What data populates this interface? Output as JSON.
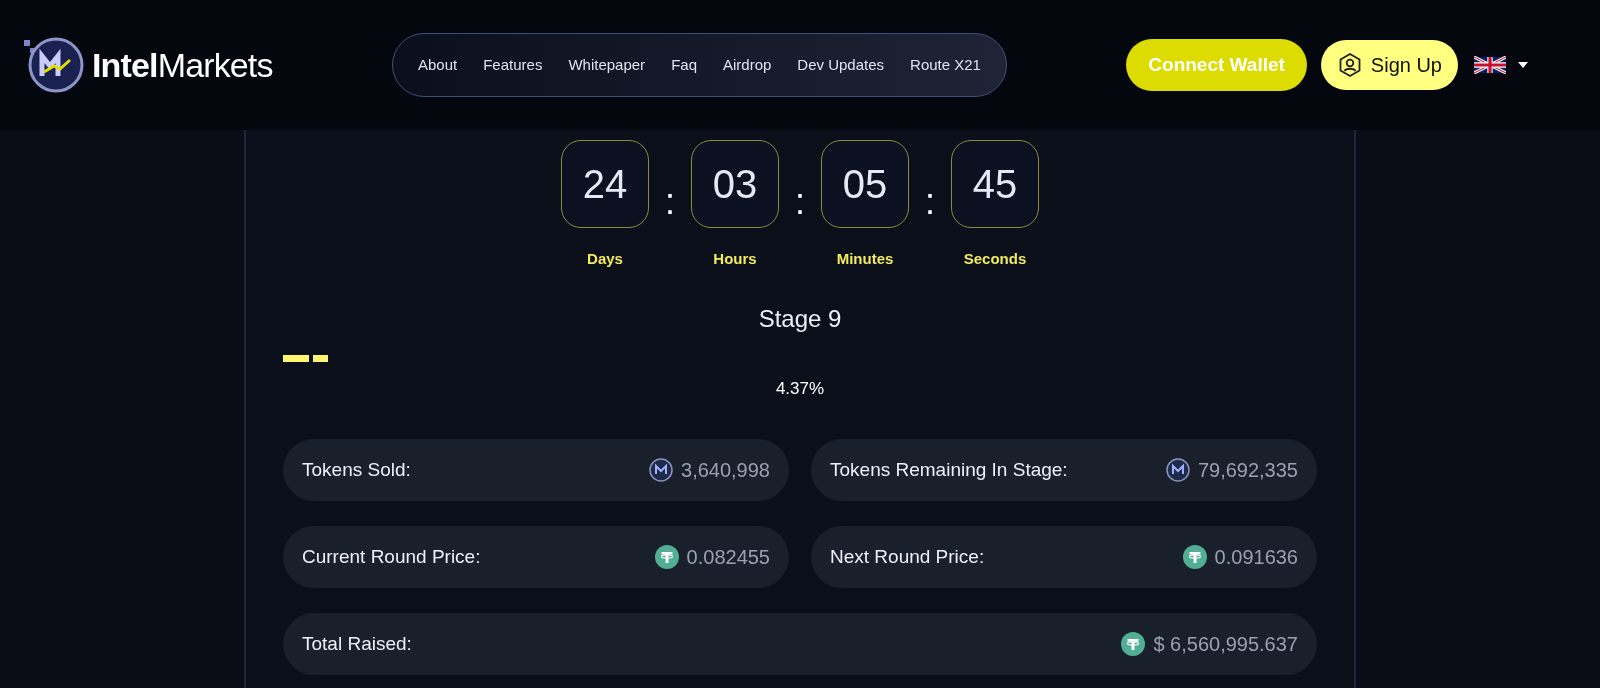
{
  "header": {
    "logo_text": {
      "bold": "Intel",
      "light": "Markets"
    },
    "nav": [
      {
        "label": "About"
      },
      {
        "label": "Features"
      },
      {
        "label": "Whitepaper"
      },
      {
        "label": "Faq"
      },
      {
        "label": "Airdrop"
      },
      {
        "label": "Dev Updates"
      },
      {
        "label": "Route X21"
      }
    ],
    "connect_button": "Connect Wallet",
    "signup_button": "Sign Up"
  },
  "countdown": [
    {
      "value": "24",
      "unit": "Days"
    },
    {
      "value": "03",
      "unit": "Hours"
    },
    {
      "value": "05",
      "unit": "Minutes"
    },
    {
      "value": "45",
      "unit": "Seconds"
    }
  ],
  "separator": ":",
  "stage": "Stage 9",
  "progress": {
    "level": 0.0437,
    "reading": "4.37%"
  },
  "stats": [
    {
      "label": "Tokens Sold:",
      "value": "3,640,998",
      "kind": "intel",
      "wide": false
    },
    {
      "label": "Tokens Remaining In Stage:",
      "value": "79,692,335",
      "kind": "intel",
      "wide": false
    },
    {
      "label": "Current Round Price:",
      "value": "0.082455",
      "kind": "tether",
      "wide": false
    },
    {
      "label": "Next Round Price:",
      "value": "0.091636",
      "kind": "tether",
      "wide": false
    },
    {
      "label": "Total Raised:",
      "value": "$ 6,560,995.637",
      "kind": "tether",
      "wide": true
    }
  ]
}
